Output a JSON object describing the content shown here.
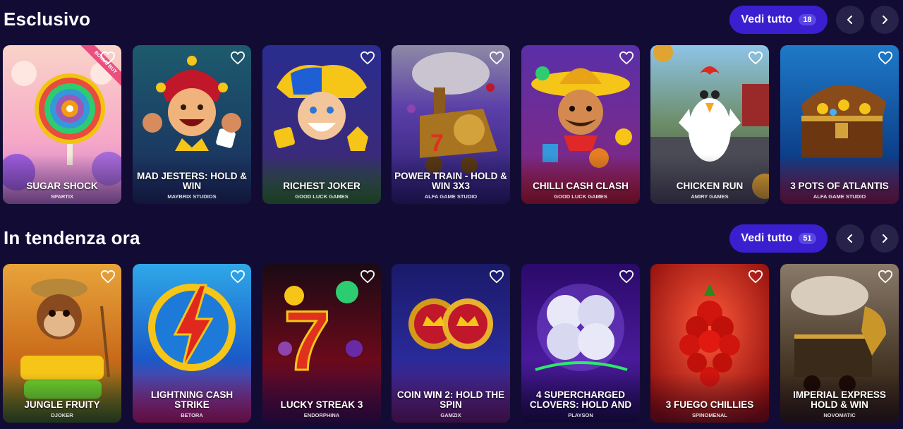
{
  "sections": [
    {
      "title": "Esclusivo",
      "see_all_label": "Vedi tutto",
      "count": "18",
      "games": [
        {
          "name": "SUGAR SHOCK",
          "provider": "SPARTIX",
          "tag": "BONUS BUY",
          "icon": "lollipop"
        },
        {
          "name": "MAD JESTERS: HOLD & WIN",
          "provider": "MAYBRIX STUDIOS",
          "icon": "jester"
        },
        {
          "name": "RICHEST JOKER",
          "provider": "GOOD LUCK GAMES",
          "icon": "joker"
        },
        {
          "name": "POWER TRAIN - HOLD & WIN 3X3",
          "provider": "ALFA GAME STUDIO",
          "icon": "train"
        },
        {
          "name": "CHILLI CASH CLASH",
          "provider": "GOOD LUCK GAMES",
          "icon": "mariachi"
        },
        {
          "name": "CHICKEN RUN",
          "provider": "AMIRY GAMES",
          "icon": "chicken"
        },
        {
          "name": "3 POTS OF ATLANTIS",
          "provider": "ALFA GAME STUDIO",
          "icon": "treasure-chest"
        }
      ]
    },
    {
      "title": "In tendenza ora",
      "see_all_label": "Vedi tutto",
      "count": "51",
      "games": [
        {
          "name": "JUNGLE FRUITY",
          "provider": "DJOKER",
          "icon": "monkey"
        },
        {
          "name": "LIGHTNING CASH STRIKE",
          "provider": "BETORA",
          "icon": "lightning"
        },
        {
          "name": "LUCKY STREAK 3",
          "provider": "ENDORPHINA",
          "icon": "lucky-seven"
        },
        {
          "name": "COIN WIN 2: HOLD THE SPIN",
          "provider": "GAMZIX",
          "icon": "coins"
        },
        {
          "name": "4 SUPERCHARGED CLOVERS: HOLD AND",
          "provider": "PLAYSON",
          "icon": "clover"
        },
        {
          "name": "3 FUEGO CHILLIES",
          "provider": "SPINOMENAL",
          "icon": "chilli"
        },
        {
          "name": "IMPERIAL EXPRESS HOLD & WIN",
          "provider": "NOVOMATIC",
          "icon": "dragon-train"
        }
      ]
    }
  ],
  "colors": {
    "background": "#120c35",
    "accent": "#3a1fd1",
    "badge": "#5a46e3",
    "nav_button": "#27224a"
  }
}
